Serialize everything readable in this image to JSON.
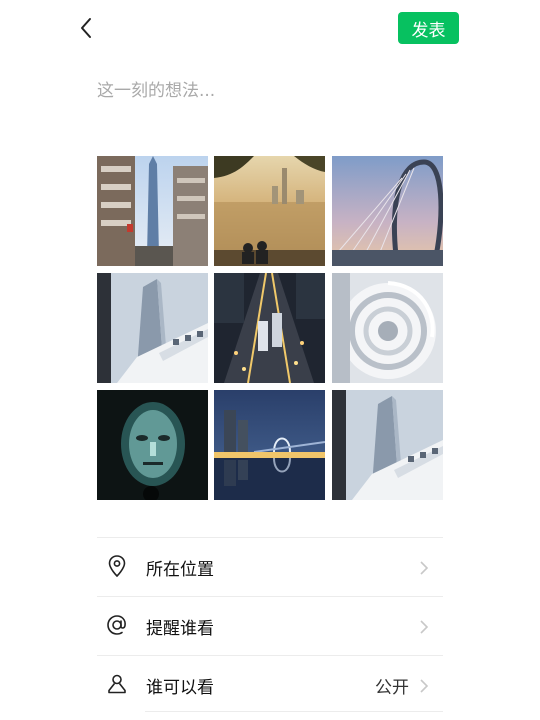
{
  "header": {
    "back_icon": "chevron-left-icon",
    "publish_label": "发表",
    "accent": "#07c160"
  },
  "composer": {
    "placeholder": "这一刻的想法..."
  },
  "photos": [
    {
      "subject": "street-skyscraper"
    },
    {
      "subject": "lake-sunset-silhouette"
    },
    {
      "subject": "cable-bridge-dusk"
    },
    {
      "subject": "white-tower-building"
    },
    {
      "subject": "night-traffic-avenue"
    },
    {
      "subject": "spiral-staircase"
    },
    {
      "subject": "light-face-sculpture"
    },
    {
      "subject": "night-skyline-reflection"
    },
    {
      "subject": "white-tower-building-2"
    }
  ],
  "menu": {
    "location": {
      "label": "所在位置",
      "icon": "location-pin-icon"
    },
    "mention": {
      "label": "提醒谁看",
      "icon": "at-sign-icon"
    },
    "visibility": {
      "label": "谁可以看",
      "icon": "person-icon",
      "value": "公开"
    }
  }
}
